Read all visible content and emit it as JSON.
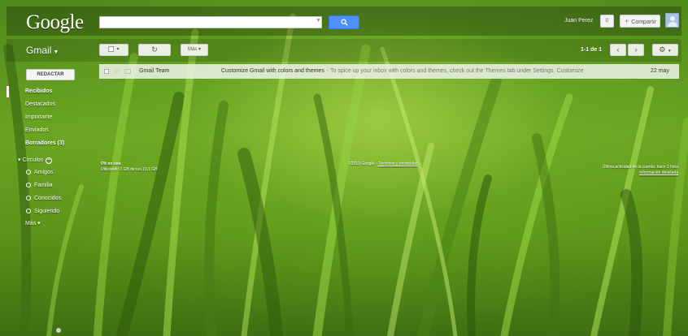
{
  "header": {
    "logo": "Google",
    "search": {
      "value": "",
      "placeholder": ""
    },
    "user_name": "Juan Perez",
    "notifications_count": "0",
    "share_label": "Compartir"
  },
  "toolbar": {
    "app_label": "Gmail",
    "more_label": "Más",
    "pagination": "1-1 de 1"
  },
  "nav": {
    "compose_label": "REDACTAR",
    "items": [
      {
        "label": "Recibidos",
        "bold": true
      },
      {
        "label": "Destacados",
        "bold": false
      },
      {
        "label": "Importante",
        "bold": false
      },
      {
        "label": "Enviados",
        "bold": false
      },
      {
        "label": "Borradores (3)",
        "bold": true
      }
    ],
    "circles_title": "Círculos",
    "circles": [
      "Amigos",
      "Familia",
      "Conocidos",
      "Siguiendo"
    ],
    "more_label": "Más"
  },
  "messages": [
    {
      "sender": "Gmail Team",
      "subject": "Customize Gmail with colors and themes",
      "snippet": "- To spice up your inbox with colors and themes, check out the Themes tab under Settings. Customize",
      "date": "22 may"
    }
  ],
  "footer": {
    "storage_percent": "0% en uso",
    "storage_detail": "Utilizando 0 GB de tus 10,1 GB",
    "copyright": "©2013 Google - ",
    "terms_link": "Términos y privacidad",
    "last_activity": "Última actividad de la cuenta: hace 1 hora",
    "details_link": "Información detallada"
  },
  "colors": {
    "search_button": "#4d90fe",
    "background_green": "#6aa322"
  },
  "icons": [
    "search-icon",
    "refresh-icon",
    "chevron-left-icon",
    "chevron-right-icon",
    "gear-icon",
    "star-icon",
    "avatar-icon"
  ]
}
